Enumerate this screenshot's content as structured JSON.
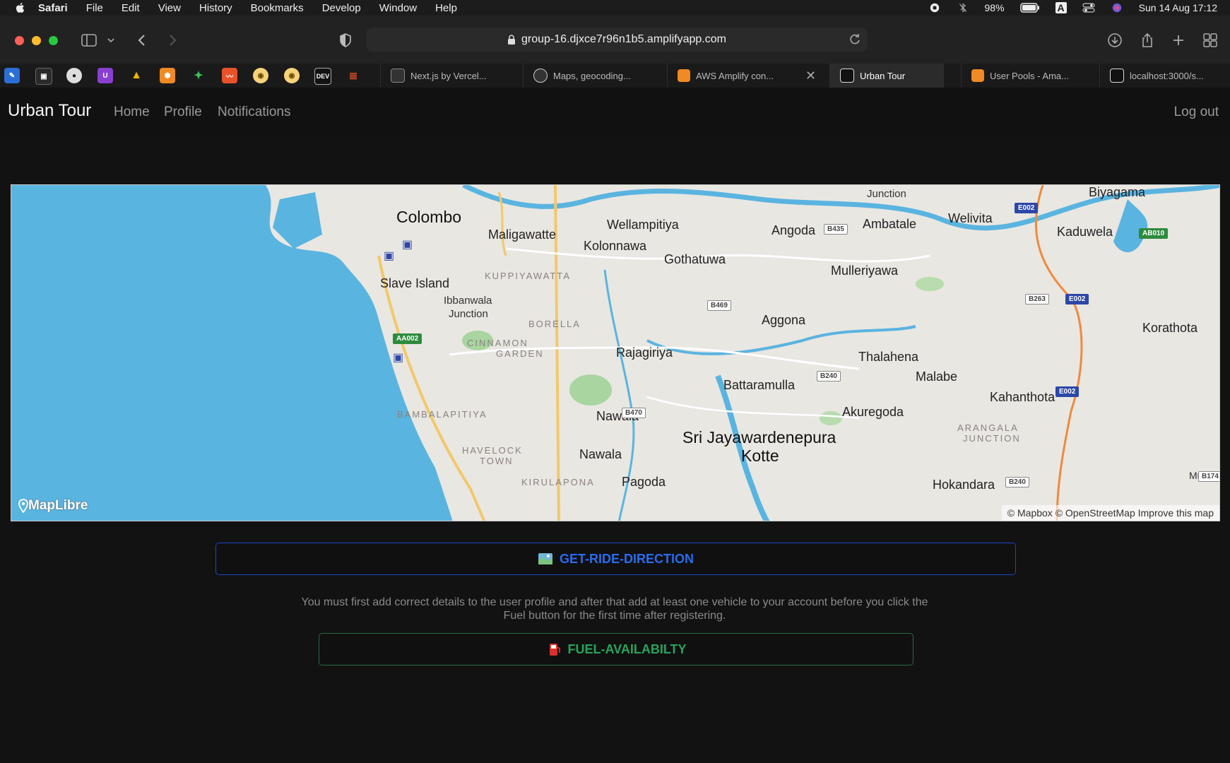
{
  "menubar": {
    "items": [
      "Safari",
      "File",
      "Edit",
      "View",
      "History",
      "Bookmarks",
      "Develop",
      "Window",
      "Help"
    ],
    "battery": "98%",
    "datetime": "Sun 14 Aug  17:12",
    "input_source": "A"
  },
  "browser": {
    "url": "group-16.djxce7r96n1b5.amplifyapp.com",
    "bookmark_labels": [
      "DEV"
    ],
    "tabs": [
      {
        "label": "Next.js by Vercel..."
      },
      {
        "label": "Maps, geocoding..."
      },
      {
        "label": "AWS Amplify con..."
      },
      {
        "label": "Urban Tour"
      },
      {
        "label": "User Pools - Ama..."
      },
      {
        "label": "localhost:3000/s..."
      }
    ]
  },
  "app": {
    "brand": "Urban Tour",
    "nav": {
      "home": "Home",
      "profile": "Profile",
      "notifications": "Notifications",
      "logout": "Log out"
    }
  },
  "map": {
    "logo": "MapLibre",
    "attribution": "© Mapbox © OpenStreetMap Improve this map",
    "big_places": [
      "Colombo",
      "Sri Jayawardenepura",
      "Kotte"
    ],
    "places": [
      "Maligawatte",
      "Wellampitiya",
      "Kolonnawa",
      "Gothatuwa",
      "Angoda",
      "Ambatale",
      "Welivita",
      "Biyagama",
      "Kaduwela",
      "Mulleriyawa",
      "Slave Island",
      "Ibbanwala",
      "Junction",
      "Aggona",
      "Korathota",
      "Rajagiriya",
      "Thalahena",
      "Malabe",
      "Battaramulla",
      "Kahanthota",
      "Akuregoda",
      "Nawala",
      "Nawala",
      "Pagoda",
      "Hokandara",
      "Junction",
      "Mulle"
    ],
    "districts": [
      "KUPPIYAWATTA",
      "BORELLA",
      "CINNAMON",
      "GARDEN",
      "BAMBALAPITIYA",
      "HAVELOCK",
      "TOWN",
      "KIRULAPONA",
      "ARANGALA",
      "JUNCTION"
    ],
    "shields": [
      "E002",
      "AB010",
      "B435",
      "B469",
      "B263",
      "E002",
      "AA002",
      "B240",
      "E002",
      "B470",
      "B240",
      "B174"
    ]
  },
  "actions": {
    "ride_label": "GET-RIDE-DIRECTION",
    "notice": "You must first add correct details to the user profile and after that add at least one vehicle to your account before you click the Fuel button for the first time after registering.",
    "fuel_label": "FUEL-AVAILABILTY"
  },
  "colors": {
    "ride_button": "#2a6bf0",
    "fuel_button": "#27a25c",
    "water": "#5ab4e0"
  }
}
